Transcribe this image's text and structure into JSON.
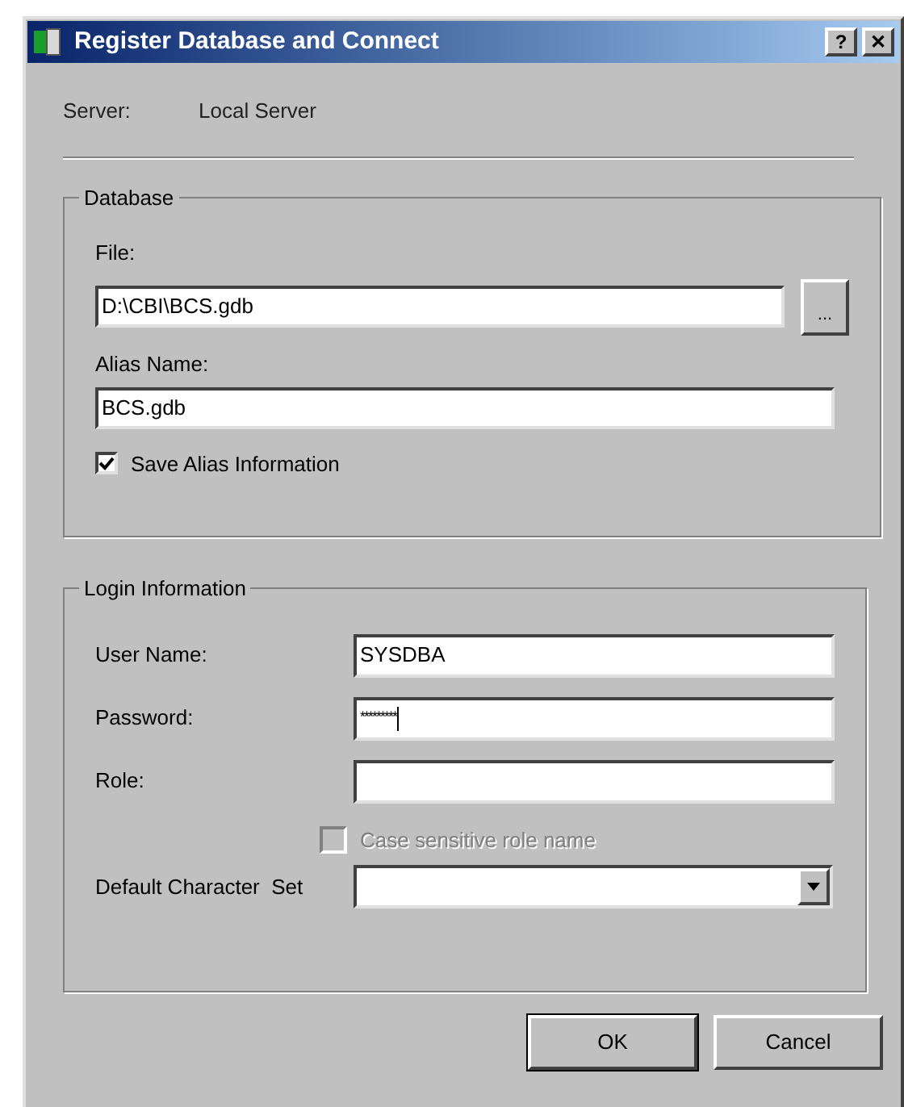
{
  "window": {
    "title": "Register Database and Connect",
    "buttons": [
      "?",
      "✕"
    ]
  },
  "server": {
    "label": "Server:",
    "value": "Local Server"
  },
  "database": {
    "title": "Database",
    "file_label": "File:",
    "file_value": "D:\\CBI\\BCS.gdb",
    "browse_button": "...",
    "alias_label": "Alias Name:",
    "alias_value": "BCS.gdb",
    "save_alias": {
      "label": "Save Alias Information",
      "checked": true
    }
  },
  "login": {
    "title": "Login Information",
    "fields": [
      {
        "label": "User Name:",
        "value": "SYSDBA",
        "kind": "text"
      },
      {
        "label": "Password:",
        "value": "*********",
        "kind": "password"
      },
      {
        "label": "Role:",
        "kind": "text"
      }
    ],
    "case_sensitive": {
      "label": "Case sensitive role name",
      "checked": false,
      "disabled": true
    },
    "charset_label": "Default Character  Set"
  },
  "buttons": [
    {
      "label": "OK",
      "default": true
    },
    {
      "label": "Cancel",
      "default": false
    }
  ]
}
